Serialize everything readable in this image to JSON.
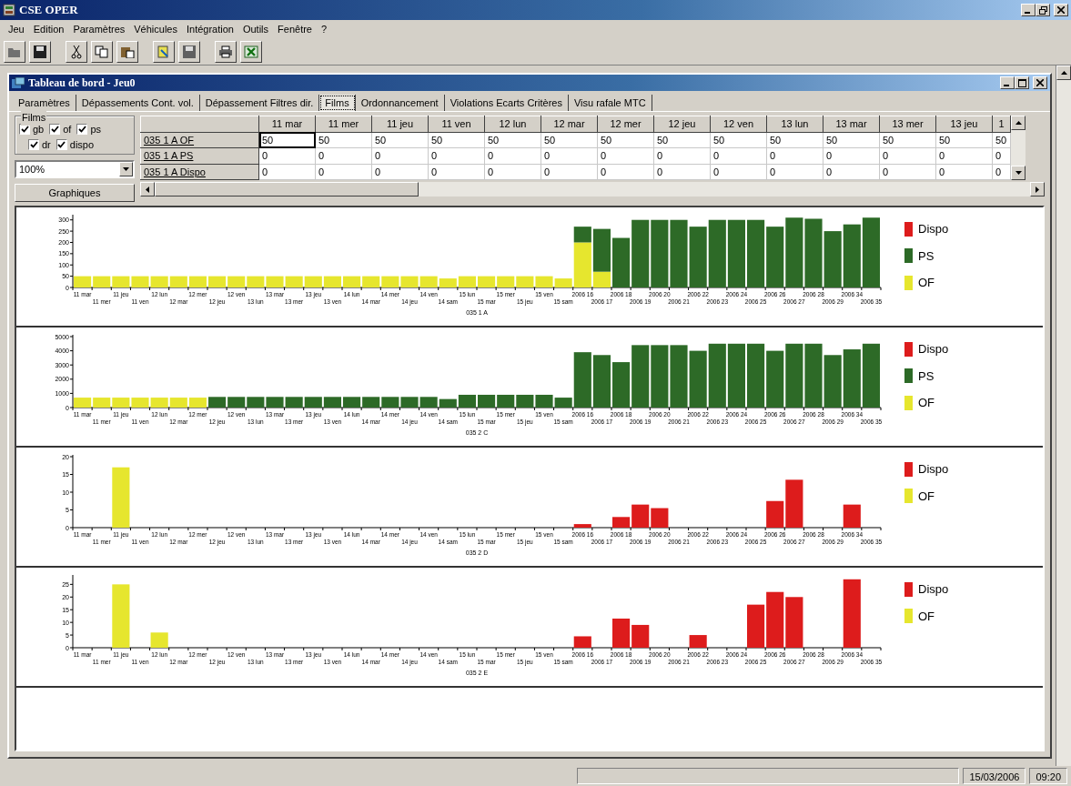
{
  "window": {
    "title": "CSE OPER"
  },
  "menu": [
    "Jeu",
    "Edition",
    "Paramètres",
    "Véhicules",
    "Intégration",
    "Outils",
    "Fenêtre",
    "?"
  ],
  "child_window": {
    "title": "Tableau de bord - Jeu0"
  },
  "tabs": [
    {
      "label": "Paramètres",
      "selected": false
    },
    {
      "label": "Dépassements Cont. vol.",
      "selected": false
    },
    {
      "label": "Dépassement Filtres dir.",
      "selected": false
    },
    {
      "label": "Films",
      "selected": true
    },
    {
      "label": "Ordonnancement",
      "selected": false
    },
    {
      "label": "Violations Ecarts Critères",
      "selected": false
    },
    {
      "label": "Visu rafale MTC",
      "selected": false
    }
  ],
  "films_group": {
    "title": "Films",
    "checkboxes": [
      {
        "label": "gb",
        "checked": true
      },
      {
        "label": "of",
        "checked": true
      },
      {
        "label": "ps",
        "checked": true
      },
      {
        "label": "dr",
        "checked": true
      },
      {
        "label": "dispo",
        "checked": true
      }
    ]
  },
  "zoom_select": {
    "value": "100%"
  },
  "graph_button": {
    "label": "Graphiques"
  },
  "grid": {
    "columns": [
      "11 mar",
      "11 mer",
      "11 jeu",
      "11 ven",
      "12 lun",
      "12 mar",
      "12 mer",
      "12 jeu",
      "12 ven",
      "13 lun",
      "13 mar",
      "13 mer",
      "13 jeu",
      "1"
    ],
    "rows": [
      {
        "label": "035 1 A OF",
        "cells": [
          {
            "text": "50",
            "selected": true
          },
          {
            "text": "50",
            "selected": false
          },
          {
            "text": "50",
            "selected": false
          },
          {
            "text": "50",
            "selected": false
          },
          {
            "text": "50",
            "selected": false
          },
          {
            "text": "50",
            "selected": false
          },
          {
            "text": "50",
            "selected": false
          },
          {
            "text": "50",
            "selected": false
          },
          {
            "text": "50",
            "selected": false
          },
          {
            "text": "50",
            "selected": false
          },
          {
            "text": "50",
            "selected": false
          },
          {
            "text": "50",
            "selected": false
          },
          {
            "text": "50",
            "selected": false
          },
          {
            "text": "50",
            "selected": false
          }
        ]
      },
      {
        "label": "035 1 A PS",
        "cells": [
          {
            "text": "0",
            "selected": false
          },
          {
            "text": "0",
            "selected": false
          },
          {
            "text": "0",
            "selected": false
          },
          {
            "text": "0",
            "selected": false
          },
          {
            "text": "0",
            "selected": false
          },
          {
            "text": "0",
            "selected": false
          },
          {
            "text": "0",
            "selected": false
          },
          {
            "text": "0",
            "selected": false
          },
          {
            "text": "0",
            "selected": false
          },
          {
            "text": "0",
            "selected": false
          },
          {
            "text": "0",
            "selected": false
          },
          {
            "text": "0",
            "selected": false
          },
          {
            "text": "0",
            "selected": false
          },
          {
            "text": "0",
            "selected": false
          }
        ]
      },
      {
        "label": "035 1 A Dispo",
        "cells": [
          {
            "text": "0",
            "selected": false
          },
          {
            "text": "0",
            "selected": false
          },
          {
            "text": "0",
            "selected": false
          },
          {
            "text": "0",
            "selected": false
          },
          {
            "text": "0",
            "selected": false
          },
          {
            "text": "0",
            "selected": false
          },
          {
            "text": "0",
            "selected": false
          },
          {
            "text": "0",
            "selected": false
          },
          {
            "text": "0",
            "selected": false
          },
          {
            "text": "0",
            "selected": false
          },
          {
            "text": "0",
            "selected": false
          },
          {
            "text": "0",
            "selected": false
          },
          {
            "text": "0",
            "selected": false
          },
          {
            "text": "0",
            "selected": false
          }
        ]
      }
    ]
  },
  "charts": [
    {
      "chart_data": {
        "type": "bar",
        "stacked": true,
        "xlabel": "035 1 A",
        "ylim": [
          0,
          315
        ],
        "yticks": [
          0,
          50,
          100,
          150,
          200,
          250,
          300
        ],
        "categories": [
          "11 mar",
          "11 mer",
          "11 jeu",
          "11 ven",
          "12 lun",
          "12 mar",
          "12 mer",
          "12 jeu",
          "12 ven",
          "13 lun",
          "13 mar",
          "13 mer",
          "13 jeu",
          "13 ven",
          "14 lun",
          "14 mar",
          "14 mer",
          "14 jeu",
          "14 ven",
          "14 sam",
          "15 lun",
          "15 mar",
          "15 mer",
          "15 jeu",
          "15 ven",
          "15 sam",
          "2006 16",
          "2006 17",
          "2006 18",
          "2006 19",
          "2006 20",
          "2006 21",
          "2006 22",
          "2006 23",
          "2006 24",
          "2006 25",
          "2006 26",
          "2006 27",
          "2006 28",
          "2006 29",
          "2006 34",
          "2006 35"
        ],
        "series": [
          {
            "name": "OF",
            "color": "#e6e62e",
            "values": [
              50,
              50,
              50,
              50,
              50,
              50,
              50,
              50,
              50,
              50,
              50,
              50,
              50,
              50,
              50,
              50,
              50,
              50,
              50,
              40,
              50,
              50,
              50,
              50,
              50,
              40,
              200,
              70,
              null,
              null,
              null,
              null,
              null,
              null,
              null,
              null,
              null,
              null,
              null,
              null,
              null,
              null
            ]
          },
          {
            "name": "PS",
            "color": "#2d6a27",
            "values": [
              null,
              null,
              null,
              null,
              null,
              null,
              null,
              null,
              null,
              null,
              null,
              null,
              null,
              null,
              null,
              null,
              null,
              null,
              null,
              null,
              null,
              null,
              null,
              null,
              null,
              null,
              70,
              190,
              220,
              300,
              300,
              300,
              270,
              300,
              300,
              300,
              270,
              310,
              305,
              250,
              280,
              310
            ]
          },
          {
            "name": "Dispo",
            "color": "#dd1c1c",
            "values": [
              null,
              null,
              null,
              null,
              null,
              null,
              null,
              null,
              null,
              null,
              null,
              null,
              null,
              null,
              null,
              null,
              null,
              null,
              null,
              null,
              null,
              null,
              null,
              null,
              null,
              null,
              null,
              null,
              null,
              null,
              null,
              null,
              null,
              null,
              null,
              null,
              null,
              null,
              null,
              null,
              null,
              null
            ]
          }
        ]
      }
    },
    {
      "chart_data": {
        "type": "bar",
        "stacked": true,
        "xlabel": "035 2 C",
        "ylim": [
          0,
          5000
        ],
        "yticks": [
          0,
          1000,
          2000,
          3000,
          4000,
          5000
        ],
        "categories": [
          "11 mar",
          "11 mer",
          "11 jeu",
          "11 ven",
          "12 lun",
          "12 mar",
          "12 mer",
          "12 jeu",
          "12 ven",
          "13 lun",
          "13 mar",
          "13 mer",
          "13 jeu",
          "13 ven",
          "14 lun",
          "14 mar",
          "14 mer",
          "14 jeu",
          "14 ven",
          "14 sam",
          "15 lun",
          "15 mar",
          "15 mer",
          "15 jeu",
          "15 ven",
          "15 sam",
          "2006 16",
          "2006 17",
          "2006 18",
          "2006 19",
          "2006 20",
          "2006 21",
          "2006 22",
          "2006 23",
          "2006 24",
          "2006 25",
          "2006 26",
          "2006 27",
          "2006 28",
          "2006 29",
          "2006 34",
          "2006 35"
        ],
        "series": [
          {
            "name": "OF",
            "color": "#e6e62e",
            "values": [
              700,
              700,
              700,
              700,
              700,
              700,
              700,
              null,
              null,
              null,
              null,
              null,
              null,
              null,
              null,
              null,
              null,
              null,
              null,
              null,
              null,
              null,
              null,
              null,
              null,
              null,
              null,
              null,
              null,
              null,
              null,
              null,
              null,
              null,
              null,
              null,
              null,
              null,
              null,
              null,
              null,
              null
            ]
          },
          {
            "name": "PS",
            "color": "#2d6a27",
            "values": [
              null,
              null,
              null,
              null,
              null,
              null,
              null,
              750,
              750,
              750,
              750,
              750,
              750,
              750,
              750,
              750,
              750,
              750,
              750,
              600,
              900,
              900,
              900,
              900,
              900,
              700,
              3900,
              3700,
              3200,
              4400,
              4400,
              4400,
              4000,
              4500,
              4500,
              4500,
              4000,
              4500,
              4500,
              3700,
              4100,
              4500
            ]
          },
          {
            "name": "Dispo",
            "color": "#dd1c1c",
            "values": [
              null,
              null,
              null,
              null,
              null,
              null,
              null,
              null,
              null,
              null,
              null,
              null,
              null,
              null,
              null,
              null,
              null,
              null,
              null,
              null,
              null,
              null,
              null,
              null,
              null,
              null,
              null,
              null,
              null,
              null,
              null,
              null,
              null,
              null,
              null,
              null,
              null,
              null,
              null,
              null,
              null,
              null
            ]
          }
        ]
      }
    },
    {
      "chart_data": {
        "type": "bar",
        "stacked": true,
        "xlabel": "035 2 D",
        "ylim": [
          0,
          20
        ],
        "yticks": [
          0,
          5,
          10,
          15,
          20
        ],
        "categories": [
          "11 mar",
          "11 mer",
          "11 jeu",
          "11 ven",
          "12 lun",
          "12 mar",
          "12 mer",
          "12 jeu",
          "12 ven",
          "13 lun",
          "13 mar",
          "13 mer",
          "13 jeu",
          "13 ven",
          "14 lun",
          "14 mar",
          "14 mer",
          "14 jeu",
          "14 ven",
          "14 sam",
          "15 lun",
          "15 mar",
          "15 mer",
          "15 jeu",
          "15 ven",
          "15 sam",
          "2006 16",
          "2006 17",
          "2006 18",
          "2006 19",
          "2006 20",
          "2006 21",
          "2006 22",
          "2006 23",
          "2006 24",
          "2006 25",
          "2006 26",
          "2006 27",
          "2006 28",
          "2006 29",
          "2006 34",
          "2006 35"
        ],
        "series": [
          {
            "name": "OF",
            "color": "#e6e62e",
            "values": [
              null,
              null,
              17,
              null,
              null,
              null,
              null,
              null,
              null,
              null,
              null,
              null,
              null,
              null,
              null,
              null,
              null,
              null,
              null,
              null,
              null,
              null,
              null,
              null,
              null,
              null,
              null,
              null,
              null,
              null,
              null,
              null,
              null,
              null,
              null,
              null,
              null,
              null,
              null,
              null,
              null,
              null
            ]
          },
          {
            "name": "Dispo",
            "color": "#dd1c1c",
            "values": [
              null,
              null,
              null,
              null,
              null,
              null,
              null,
              null,
              null,
              null,
              null,
              null,
              null,
              null,
              null,
              null,
              null,
              null,
              null,
              null,
              null,
              null,
              null,
              null,
              null,
              null,
              1,
              null,
              3,
              6.5,
              5.5,
              null,
              null,
              null,
              null,
              null,
              7.5,
              13.5,
              null,
              null,
              6.5,
              null
            ]
          }
        ]
      }
    },
    {
      "chart_data": {
        "type": "bar",
        "stacked": true,
        "xlabel": "035 2 E",
        "ylim": [
          0,
          28
        ],
        "yticks": [
          0,
          5,
          10,
          15,
          20,
          25
        ],
        "categories": [
          "11 mar",
          "11 mer",
          "11 jeu",
          "11 ven",
          "12 lun",
          "12 mar",
          "12 mer",
          "12 jeu",
          "12 ven",
          "13 lun",
          "13 mar",
          "13 mer",
          "13 jeu",
          "13 ven",
          "14 lun",
          "14 mar",
          "14 mer",
          "14 jeu",
          "14 ven",
          "14 sam",
          "15 lun",
          "15 mar",
          "15 mer",
          "15 jeu",
          "15 ven",
          "15 sam",
          "2006 16",
          "2006 17",
          "2006 18",
          "2006 19",
          "2006 20",
          "2006 21",
          "2006 22",
          "2006 23",
          "2006 24",
          "2006 25",
          "2006 26",
          "2006 27",
          "2006 28",
          "2006 29",
          "2006 34",
          "2006 35"
        ],
        "series": [
          {
            "name": "OF",
            "color": "#e6e62e",
            "values": [
              null,
              null,
              25,
              null,
              6,
              null,
              null,
              null,
              null,
              null,
              null,
              null,
              null,
              null,
              null,
              null,
              null,
              null,
              null,
              null,
              null,
              null,
              null,
              null,
              null,
              null,
              null,
              null,
              null,
              null,
              null,
              null,
              null,
              null,
              null,
              null,
              null,
              null,
              null,
              null,
              null,
              null
            ]
          },
          {
            "name": "Dispo",
            "color": "#dd1c1c",
            "values": [
              null,
              null,
              null,
              null,
              null,
              null,
              null,
              null,
              null,
              null,
              null,
              null,
              null,
              null,
              null,
              null,
              null,
              null,
              null,
              null,
              null,
              null,
              null,
              null,
              null,
              null,
              4.5,
              null,
              11.5,
              9,
              null,
              null,
              5,
              null,
              null,
              17,
              22,
              20,
              null,
              null,
              27,
              null
            ]
          }
        ]
      }
    }
  ],
  "status_bar": {
    "date": "15/03/2006",
    "time": "09:20"
  }
}
